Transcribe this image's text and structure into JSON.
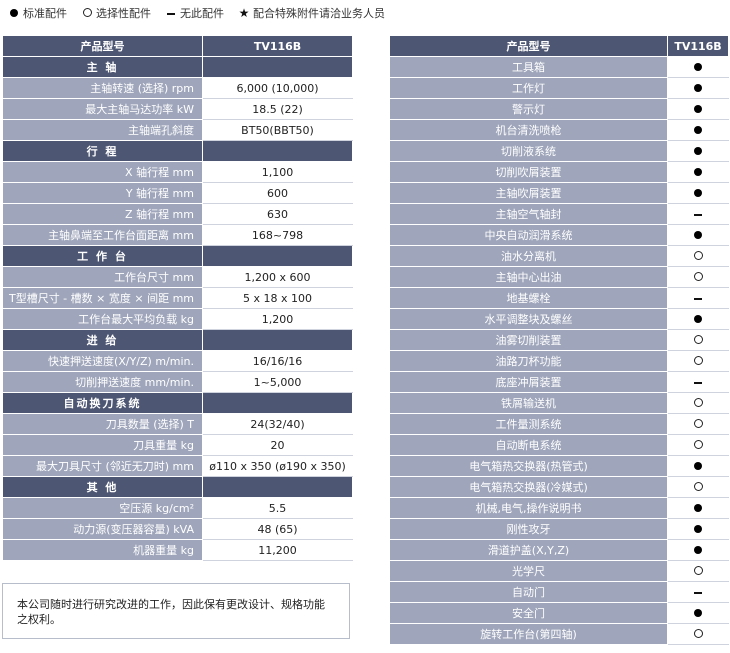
{
  "legend": [
    {
      "icon": "filled-circle-icon",
      "label": "标准配件"
    },
    {
      "icon": "open-circle-icon",
      "label": "选择性配件"
    },
    {
      "icon": "dash-icon",
      "label": "无此配件"
    },
    {
      "icon": "star-icon",
      "label": "配合特殊附件请洽业务人员"
    }
  ],
  "spec": {
    "header": {
      "label": "产品型号",
      "model": "TV116B"
    },
    "sections": [
      {
        "title": "主 轴",
        "rows": [
          {
            "label": "主轴转速 (选择) rpm",
            "value": "6,000 (10,000)"
          },
          {
            "label": "最大主轴马达功率 kW",
            "value": "18.5 (22)"
          },
          {
            "label": "主轴端孔斜度",
            "value": "BT50(BBT50)"
          }
        ]
      },
      {
        "title": "行 程",
        "rows": [
          {
            "label": "X 轴行程 mm",
            "value": "1,100"
          },
          {
            "label": "Y 轴行程 mm",
            "value": "600"
          },
          {
            "label": "Z 轴行程 mm",
            "value": "630"
          },
          {
            "label": "主轴鼻端至工作台面距离 mm",
            "value": "168~798"
          }
        ]
      },
      {
        "title": "工 作 台",
        "rows": [
          {
            "label": "工作台尺寸 mm",
            "value": "1,200 x 600"
          },
          {
            "label": "T型槽尺寸 - 槽数 × 宽度 × 间距 mm",
            "value": "5 x 18 x 100"
          },
          {
            "label": "工作台最大平均负载 kg",
            "value": "1,200"
          }
        ]
      },
      {
        "title": "进 给",
        "rows": [
          {
            "label": "快速押送速度(X/Y/Z) m/min.",
            "value": "16/16/16"
          },
          {
            "label": "切削押送速度 mm/min.",
            "value": "1~5,000"
          }
        ]
      },
      {
        "title": "自动换刀系统",
        "rows": [
          {
            "label": "刀具数量 (选择) T",
            "value": "24(32/40)"
          },
          {
            "label": "刀具重量 kg",
            "value": "20"
          },
          {
            "label": "最大刀具尺寸 (邻近无刀时) mm",
            "value": "ø110 x 350 (ø190 x 350)"
          }
        ]
      },
      {
        "title": "其 他",
        "rows": [
          {
            "label": "空压源 kg/cm²",
            "value": "5.5"
          },
          {
            "label": "动力源(变压器容量) kVA",
            "value": "48 (65)"
          },
          {
            "label": "机器重量 kg",
            "value": "11,200"
          }
        ]
      }
    ]
  },
  "note": "本公司随时进行研究改进的工作，因此保有更改设计、规格功能之权利。",
  "accessories": {
    "header": {
      "label": "产品型号",
      "model": "TV116B"
    },
    "items": [
      {
        "name": "工具箱",
        "status": "standard"
      },
      {
        "name": "工作灯",
        "status": "standard"
      },
      {
        "name": "警示灯",
        "status": "standard"
      },
      {
        "name": "机台清洗喷枪",
        "status": "standard"
      },
      {
        "name": "切削液系统",
        "status": "standard"
      },
      {
        "name": "切削吹屑装置",
        "status": "standard"
      },
      {
        "name": "主轴吹屑装置",
        "status": "standard"
      },
      {
        "name": "主轴空气轴封",
        "status": "none"
      },
      {
        "name": "中央自动润滑系统",
        "status": "standard"
      },
      {
        "name": "油水分离机",
        "status": "optional"
      },
      {
        "name": "主轴中心出油",
        "status": "optional"
      },
      {
        "name": "地基螺栓",
        "status": "none"
      },
      {
        "name": "水平调整块及螺丝",
        "status": "standard"
      },
      {
        "name": "油雾切削装置",
        "status": "optional"
      },
      {
        "name": "油路刀杯功能",
        "status": "optional"
      },
      {
        "name": "底座冲屑装置",
        "status": "none"
      },
      {
        "name": "铁屑输送机",
        "status": "optional"
      },
      {
        "name": "工件量测系统",
        "status": "optional"
      },
      {
        "name": "自动断电系统",
        "status": "optional"
      },
      {
        "name": "电气箱热交换器(热管式)",
        "status": "standard"
      },
      {
        "name": "电气箱热交换器(冷媒式)",
        "status": "optional"
      },
      {
        "name": "机械,电气,操作说明书",
        "status": "standard"
      },
      {
        "name": "刚性攻牙",
        "status": "standard"
      },
      {
        "name": "滑道护盖(X,Y,Z)",
        "status": "standard"
      },
      {
        "name": "光学尺",
        "status": "optional"
      },
      {
        "name": "自动门",
        "status": "none"
      },
      {
        "name": "安全门",
        "status": "standard"
      },
      {
        "name": "旋转工作台(第四轴)",
        "status": "optional"
      }
    ]
  }
}
